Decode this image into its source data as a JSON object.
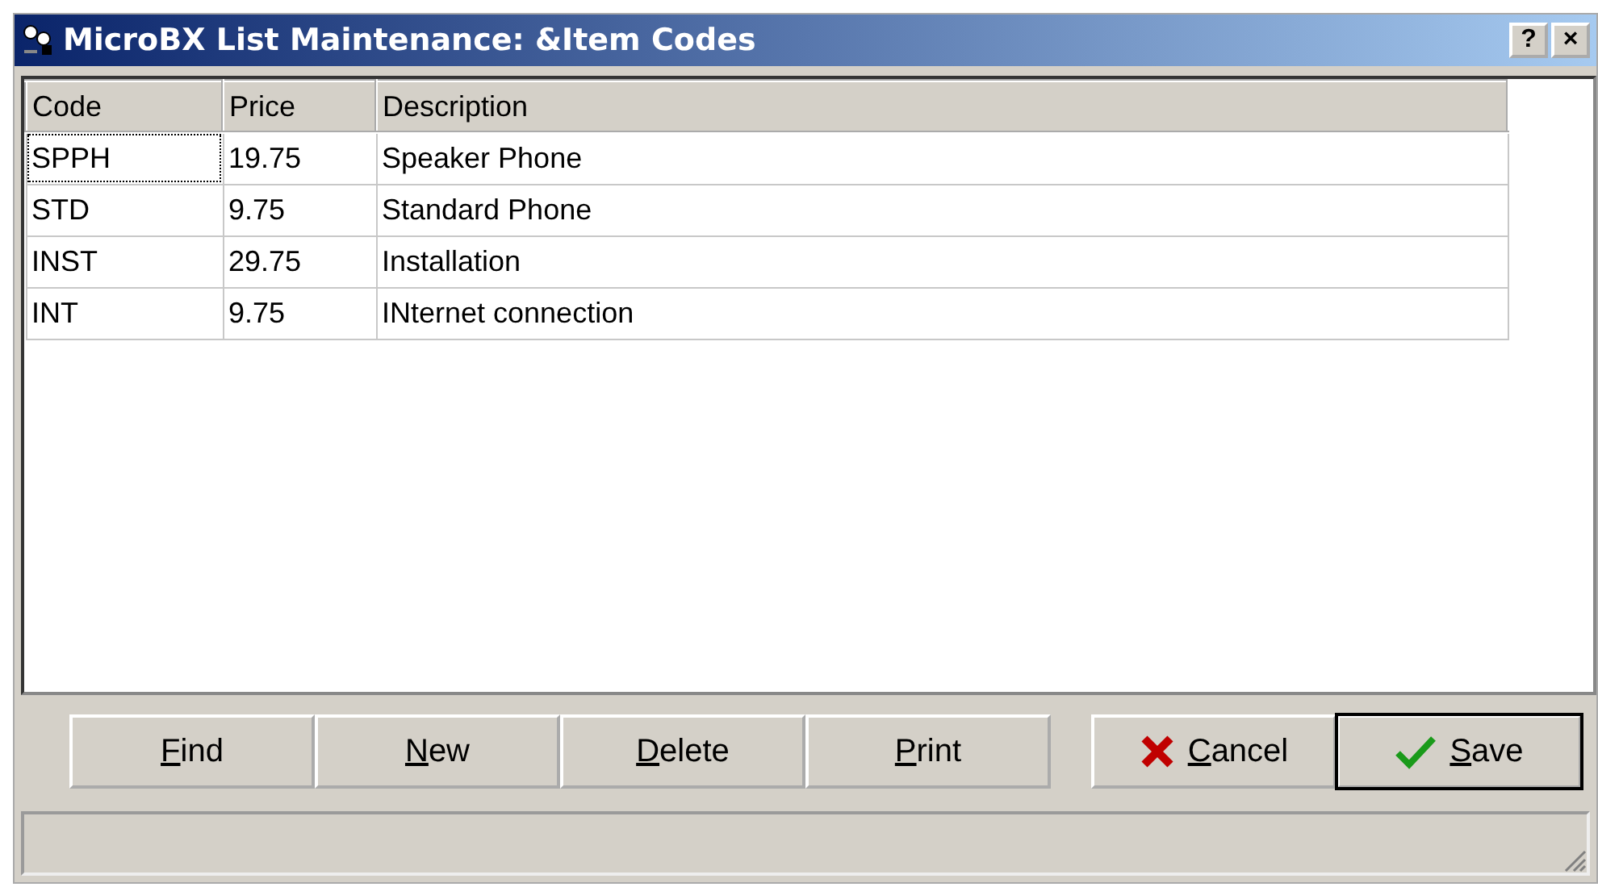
{
  "window": {
    "title": "MicroBX List Maintenance: &Item Codes",
    "help_button": "?",
    "close_button": "×"
  },
  "table": {
    "columns": [
      "Code",
      "Price",
      "Description"
    ],
    "rows": [
      {
        "cells": [
          "SPPH",
          "19.75",
          "Speaker Phone"
        ],
        "focused": true
      },
      {
        "cells": [
          "STD",
          "9.75",
          "Standard Phone"
        ],
        "focused": false
      },
      {
        "cells": [
          "INST",
          "29.75",
          "Installation"
        ],
        "focused": false
      },
      {
        "cells": [
          "INT",
          "9.75",
          "INternet connection"
        ],
        "focused": false
      }
    ]
  },
  "buttons": [
    {
      "kind": "plain",
      "accel": "F",
      "label": "ind",
      "default": false
    },
    {
      "kind": "plain",
      "accel": "N",
      "label": "ew",
      "default": false
    },
    {
      "kind": "plain",
      "accel": "D",
      "label": "elete",
      "default": false
    },
    {
      "kind": "plain",
      "accel": "P",
      "label": "rint",
      "default": false
    },
    {
      "kind": "cancel",
      "accel": "C",
      "label": "ancel",
      "default": false
    },
    {
      "kind": "save",
      "accel": "S",
      "label": "ave",
      "default": true
    }
  ]
}
